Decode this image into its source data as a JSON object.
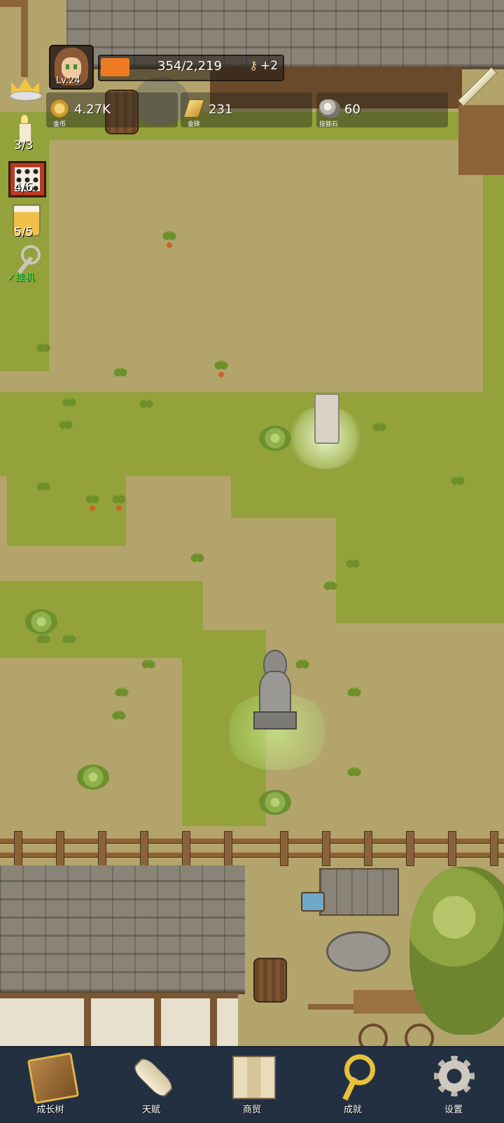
{
  "player": {
    "level": "Lv.24",
    "xp_text": "354/2,219",
    "xp_progress": 0.16,
    "key_bonus": "+2"
  },
  "resources": [
    {
      "icon": "gold-coin-icon",
      "value": "4.27K",
      "label": "金币"
    },
    {
      "icon": "gold-bar-icon",
      "value": "231",
      "label": "金砖"
    },
    {
      "icon": "skill-stone-icon",
      "value": "60",
      "label": "技能石"
    }
  ],
  "side": {
    "candle_count": "3/3",
    "dice_count": "4/6",
    "beer_count": "5/5",
    "idle_label": "挂机"
  },
  "nav": [
    {
      "icon": "book-icon",
      "label": "成长树"
    },
    {
      "icon": "scroll-icon",
      "label": "天赋"
    },
    {
      "icon": "map-icon",
      "label": "商贸"
    },
    {
      "icon": "key-icon",
      "label": "成就"
    },
    {
      "icon": "gear-icon",
      "label": "设置"
    }
  ],
  "colors": {
    "xp_fill": "#f07a22",
    "nav_bg": "#233041",
    "grass": "#93a23a",
    "dirt": "#b4a46b"
  }
}
